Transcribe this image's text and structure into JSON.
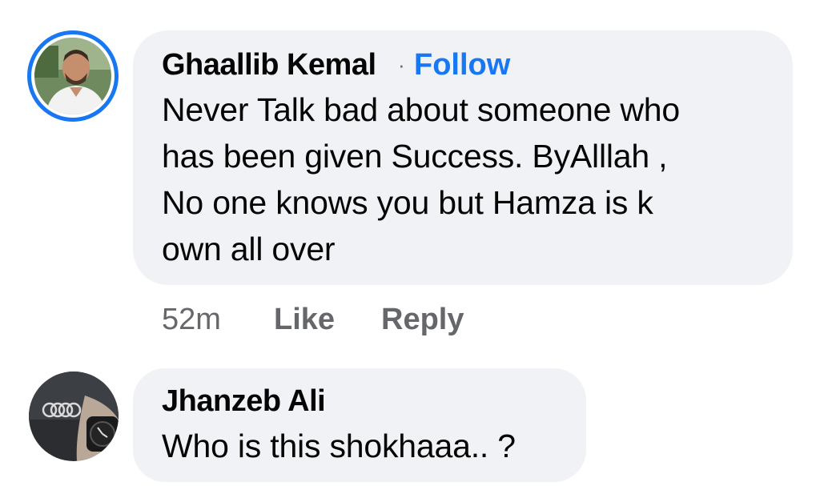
{
  "comments": [
    {
      "author": "Ghaallib Kemal",
      "separator": "·",
      "follow_label": "Follow",
      "text_lines": [
        "Never Talk bad about someone who",
        "has been given Success. ByAlllah ,",
        "No one knows you but Hamza is k",
        "own all over"
      ],
      "time": "52m",
      "like_label": "Like",
      "reply_label": "Reply"
    },
    {
      "author": "Jhanzeb Ali",
      "text_lines": [
        "Who is this shokhaaa..  ?"
      ]
    }
  ],
  "colors": {
    "bubble": "#f0f2f5",
    "follow": "#1877f2",
    "meta": "#65676b",
    "story_ring": "#1877f2"
  }
}
